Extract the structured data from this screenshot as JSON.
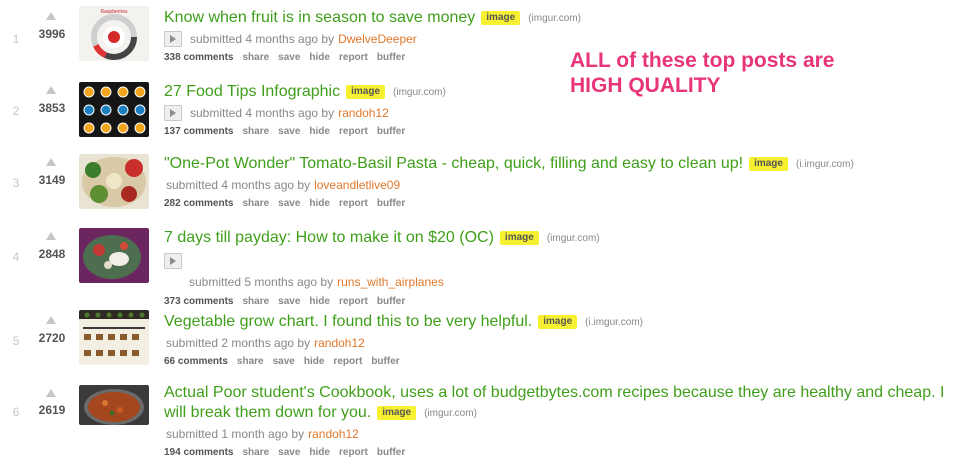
{
  "annotation": {
    "line1": "ALL of these top posts are",
    "line2": "HIGH QUALITY"
  },
  "posts": [
    {
      "rank": "1",
      "score": "3996",
      "title": "Know when fruit is in season to save money",
      "flair": "image",
      "domain": "(imgur.com)",
      "submitted": "submitted 4 months ago by",
      "author": "DwelveDeeper",
      "comments": "338 comments",
      "share": "share",
      "save": "save",
      "hide": "hide",
      "report": "report",
      "buffer": "buffer",
      "thumb_label": "Raspberries"
    },
    {
      "rank": "2",
      "score": "3853",
      "title": "27 Food Tips Infographic",
      "flair": "image",
      "domain": "(imgur.com)",
      "submitted": "submitted 4 months ago by",
      "author": "randoh12",
      "comments": "137 comments",
      "share": "share",
      "save": "save",
      "hide": "hide",
      "report": "report",
      "buffer": "buffer"
    },
    {
      "rank": "3",
      "score": "3149",
      "title": "\"One-Pot Wonder\" Tomato-Basil Pasta - cheap, quick, filling and easy to clean up!",
      "flair": "image",
      "domain": "(i.imgur.com)",
      "submitted": "submitted 4 months ago by",
      "author": "loveandletlive09",
      "comments": "282 comments",
      "share": "share",
      "save": "save",
      "hide": "hide",
      "report": "report",
      "buffer": "buffer"
    },
    {
      "rank": "4",
      "score": "2848",
      "title": "7 days till payday: How to make it on $20 (OC)",
      "flair": "image",
      "domain": "(imgur.com)",
      "submitted": "submitted 5 months ago by",
      "author": "runs_with_airplanes",
      "comments": "373 comments",
      "share": "share",
      "save": "save",
      "hide": "hide",
      "report": "report",
      "buffer": "buffer"
    },
    {
      "rank": "5",
      "score": "2720",
      "title": "Vegetable grow chart. I found this to be very helpful.",
      "flair": "image",
      "domain": "(i.imgur.com)",
      "submitted": "submitted 2 months ago by",
      "author": "randoh12",
      "comments": "66 comments",
      "share": "share",
      "save": "save",
      "hide": "hide",
      "report": "report",
      "buffer": "buffer"
    },
    {
      "rank": "6",
      "score": "2619",
      "title": "Actual Poor student's Cookbook, uses a lot of budgetbytes.com recipes because they are healthy and cheap. I will break them down for you.",
      "flair": "image",
      "domain": "(imgur.com)",
      "submitted": "submitted 1 month ago by",
      "author": "randoh12",
      "comments": "194 comments",
      "share": "share",
      "save": "save",
      "hide": "hide",
      "report": "report",
      "buffer": "buffer"
    }
  ]
}
